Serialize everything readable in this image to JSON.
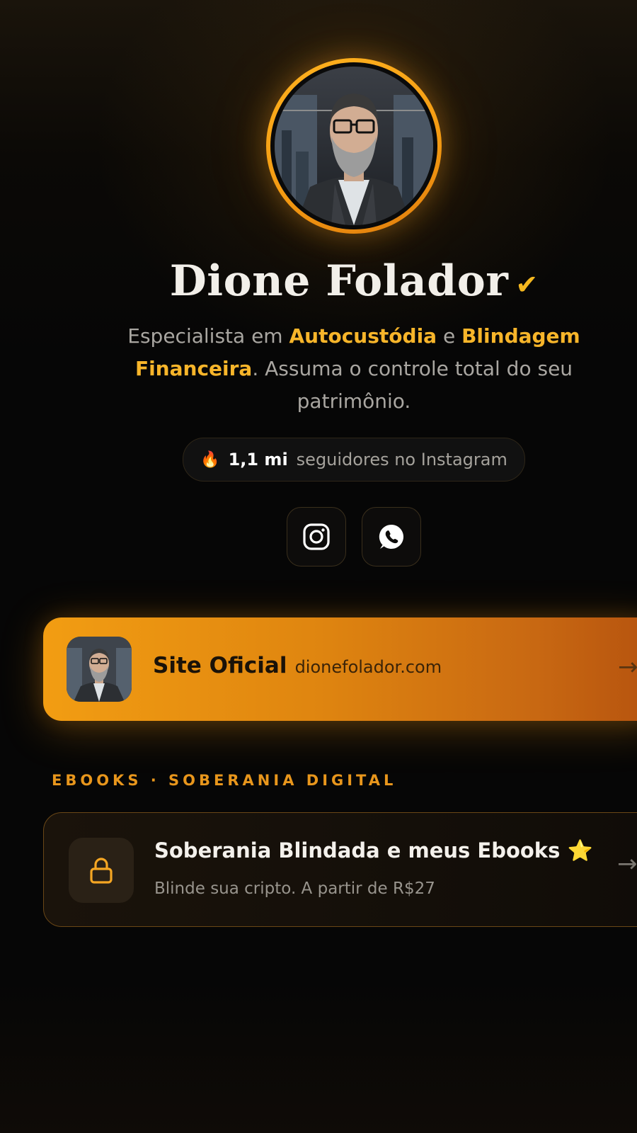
{
  "profile": {
    "name": "Dione Folador",
    "verified_mark": "✔",
    "bio": {
      "part1": "Especialista em ",
      "highlight1": "Autocustódia",
      "part2": " e ",
      "highlight2": "Blindagem Financeira",
      "part3": ". Assuma o controle total do seu patrimônio."
    },
    "followers": {
      "emoji": "🔥",
      "count": "1,1 mi",
      "suffix": "seguidores no Instagram"
    }
  },
  "social": [
    {
      "name": "instagram",
      "icon": "instagram-icon"
    },
    {
      "name": "whatsapp",
      "icon": "whatsapp-icon"
    }
  ],
  "site_card": {
    "title": "Site Oficial",
    "url": "dionefolador.com",
    "arrow": "→"
  },
  "section": {
    "label": "EBOOKS · SOBERANIA DIGITAL"
  },
  "ebook_card": {
    "icon": "lock-icon",
    "title": "Soberania Blindada e meus Ebooks",
    "star": "⭐",
    "subtitle": "Blinde sua cripto. A partir de R$27",
    "arrow": "→"
  },
  "colors": {
    "accent": "#f5a623",
    "accent_text": "#f7b52a",
    "background": "#060606",
    "card_gradient_start": "#f29d12",
    "card_gradient_end": "#b5520e"
  }
}
